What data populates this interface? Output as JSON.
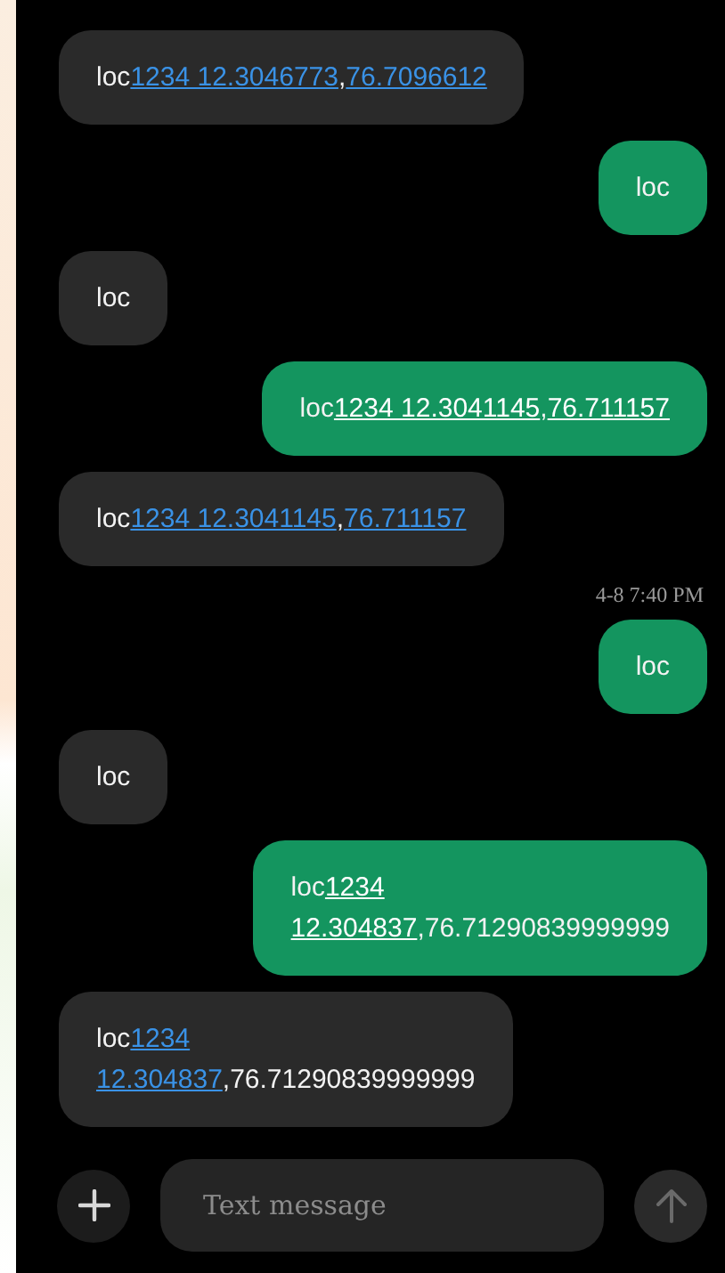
{
  "messages": [
    {
      "outgoing": false,
      "parts": [
        {
          "text": "loc",
          "link": false
        },
        {
          "text": "1234 12.3046773",
          "link": true
        },
        {
          "text": ",",
          "link": false
        },
        {
          "text": "76.7096612",
          "link": true
        }
      ]
    },
    {
      "outgoing": true,
      "parts": [
        {
          "text": "loc",
          "link": false
        }
      ]
    },
    {
      "outgoing": false,
      "parts": [
        {
          "text": "loc",
          "link": false
        }
      ]
    },
    {
      "outgoing": true,
      "parts": [
        {
          "text": "loc",
          "link": false
        },
        {
          "text": "1234 12.3041145",
          "link": true
        },
        {
          "text": ",",
          "link": false
        },
        {
          "text": "76.711157",
          "link": true
        }
      ]
    },
    {
      "outgoing": false,
      "parts": [
        {
          "text": "loc",
          "link": false
        },
        {
          "text": "1234 12.3041145",
          "link": true
        },
        {
          "text": ",",
          "link": false
        },
        {
          "text": "76.711157",
          "link": true
        }
      ]
    },
    {
      "outgoing": true,
      "timestamp": "4-8 7:40 PM",
      "parts": [
        {
          "text": "loc",
          "link": false
        }
      ]
    },
    {
      "outgoing": false,
      "parts": [
        {
          "text": "loc",
          "link": false
        }
      ]
    },
    {
      "outgoing": true,
      "parts": [
        {
          "text": "loc",
          "link": false
        },
        {
          "text": "1234",
          "link": true
        },
        {
          "text": "12.304837",
          "link": true,
          "new_line": true
        },
        {
          "text": ",76.71290839999999",
          "link": false
        }
      ]
    },
    {
      "outgoing": false,
      "parts": [
        {
          "text": "loc",
          "link": false
        },
        {
          "text": "1234",
          "link": true
        },
        {
          "text": "12.304837",
          "link": true,
          "new_line": true
        },
        {
          "text": ",76.71290839999999",
          "link": false
        }
      ]
    }
  ],
  "composer": {
    "placeholder": "Text message",
    "send_disabled": true
  }
}
